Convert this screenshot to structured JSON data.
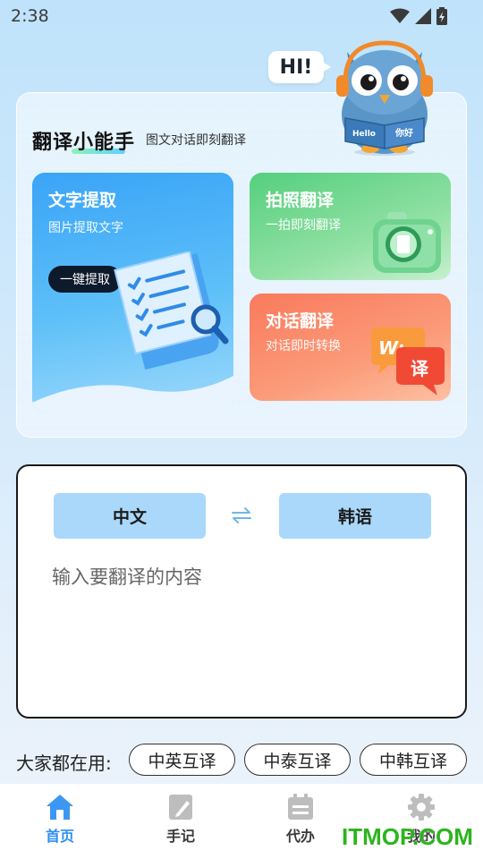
{
  "status_bar": {
    "time": "2:38"
  },
  "mascot": {
    "greeting": "HI!",
    "book_left": "Hello",
    "book_right": "你好"
  },
  "header": {
    "title": "翻译小能手",
    "subtitle": "图文对话即刻翻译"
  },
  "cards": {
    "text_extract": {
      "title": "文字提取",
      "desc": "图片提取文字",
      "button": "一键提取"
    },
    "photo_translate": {
      "title": "拍照翻译",
      "desc": "一拍即刻翻译"
    },
    "dialog_translate": {
      "title": "对话翻译",
      "desc": "对话即时转换",
      "bubble_text": "译"
    }
  },
  "translator": {
    "source_lang": "中文",
    "target_lang": "韩语",
    "placeholder": "输入要翻译的内容"
  },
  "popular": {
    "label": "大家都在用:",
    "chips": [
      "中英互译",
      "中泰互译",
      "中韩互译"
    ]
  },
  "tabbar": {
    "items": [
      {
        "label": "首页",
        "icon": "home-icon",
        "active": true
      },
      {
        "label": "手记",
        "icon": "notebook-icon",
        "active": false
      },
      {
        "label": "代办",
        "icon": "calendar-icon",
        "active": false
      },
      {
        "label": "我的",
        "icon": "gear-icon",
        "active": false
      }
    ]
  },
  "watermark": "ITMOP.COM",
  "colors": {
    "accent_blue": "#2d8ff0",
    "card_blue": "#3aa4f7",
    "card_green": "#55cf7e",
    "card_orange": "#fa7a5d",
    "lang_button": "#a9d8fb",
    "watermark_green": "#2bb51c"
  }
}
